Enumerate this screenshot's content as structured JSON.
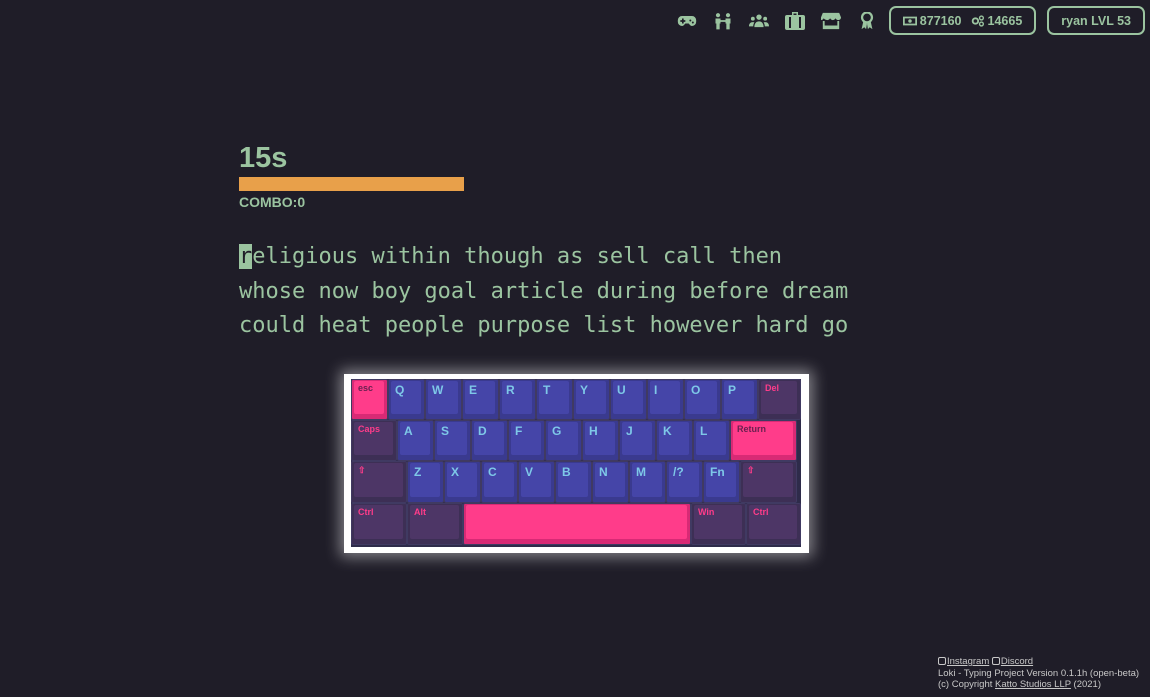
{
  "nav": {
    "icons": [
      "gamepad-icon",
      "duel-icon",
      "friends-icon",
      "inventory-icon",
      "shop-icon",
      "achievements-icon"
    ]
  },
  "stats": {
    "money": "877160",
    "gears": "14665"
  },
  "user": {
    "label": "ryan LVL 53"
  },
  "game": {
    "timer": "15s",
    "time_remaining_fraction": 1.0,
    "combo": "COMBO:0",
    "current_char": "r",
    "lines": [
      "eligious within though as sell call then",
      "whose now boy goal article during before dream",
      "could heat people purpose list however hard go"
    ]
  },
  "keyboard": {
    "rows": [
      [
        {
          "l": "esc",
          "t": "pink"
        },
        {
          "l": "Q",
          "t": "alpha"
        },
        {
          "l": "W",
          "t": "alpha"
        },
        {
          "l": "E",
          "t": "alpha"
        },
        {
          "l": "R",
          "t": "alpha"
        },
        {
          "l": "T",
          "t": "alpha"
        },
        {
          "l": "Y",
          "t": "alpha"
        },
        {
          "l": "U",
          "t": "alpha"
        },
        {
          "l": "I",
          "t": "alpha"
        },
        {
          "l": "O",
          "t": "alpha"
        },
        {
          "l": "P",
          "t": "alpha"
        },
        {
          "l": "Del",
          "t": "mod"
        }
      ],
      [
        {
          "l": "Caps",
          "t": "mod"
        },
        {
          "l": "A",
          "t": "alpha"
        },
        {
          "l": "S",
          "t": "alpha"
        },
        {
          "l": "D",
          "t": "alpha"
        },
        {
          "l": "F",
          "t": "alpha"
        },
        {
          "l": "G",
          "t": "alpha"
        },
        {
          "l": "H",
          "t": "alpha"
        },
        {
          "l": "J",
          "t": "alpha"
        },
        {
          "l": "K",
          "t": "alpha"
        },
        {
          "l": "L",
          "t": "alpha"
        },
        {
          "l": "Return",
          "t": "pink"
        }
      ],
      [
        {
          "l": "⇧",
          "t": "mod"
        },
        {
          "l": "Z",
          "t": "alpha"
        },
        {
          "l": "X",
          "t": "alpha"
        },
        {
          "l": "C",
          "t": "alpha"
        },
        {
          "l": "V",
          "t": "alpha"
        },
        {
          "l": "B",
          "t": "alpha"
        },
        {
          "l": "N",
          "t": "alpha"
        },
        {
          "l": "M",
          "t": "alpha"
        },
        {
          "l": "/?",
          "t": "alpha"
        },
        {
          "l": "Fn",
          "t": "alpha"
        },
        {
          "l": "⇧",
          "t": "mod"
        }
      ],
      [
        {
          "l": "Ctrl",
          "t": "mod"
        },
        {
          "l": "Alt",
          "t": "mod"
        },
        {
          "l": "",
          "t": "pink"
        },
        {
          "l": "Win",
          "t": "mod"
        },
        {
          "l": "Ctrl",
          "t": "mod"
        }
      ]
    ]
  },
  "footer": {
    "instagram": "Instagram",
    "discord": "Discord",
    "version": "Loki - Typing Project Version 0.1.1h (open-beta)",
    "copyright_prefix": "(c) Copyright ",
    "studio": "Katto Studios LLP",
    "copyright_suffix": " (2021)"
  },
  "colors": {
    "background": "#1f1d28",
    "text": "#9bc4a0",
    "timer_bar": "#e8a04a",
    "key_alpha": "#4545a8",
    "key_mod": "#4d3666",
    "key_accent": "#ff3c8a"
  }
}
